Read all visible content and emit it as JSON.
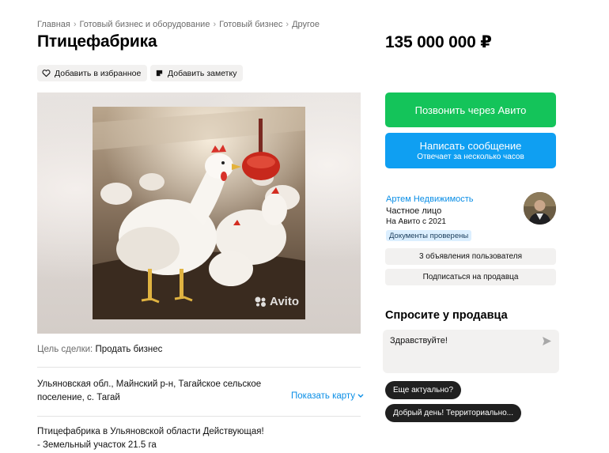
{
  "breadcrumb": [
    {
      "label": "Главная"
    },
    {
      "label": "Готовый бизнес и оборудование"
    },
    {
      "label": "Готовый бизнес"
    },
    {
      "label": "Другое"
    }
  ],
  "title": "Птицефабрика",
  "price": "135 000 000 ₽",
  "actions": {
    "favorite_label": "Добавить в избранное",
    "note_label": "Добавить заметку"
  },
  "gallery": {
    "watermark": "Avito"
  },
  "deal": {
    "label": "Цель сделки:",
    "value": "Продать бизнес"
  },
  "address": {
    "text": "Ульяновская обл., Майнский р-н, Тагайское сельское поселение, с. Тагай",
    "show_map_label": "Показать карту"
  },
  "description": {
    "line1": "Птицефабрика в Ульяновской области Действующая!",
    "line2": "- Земельный участок 21.5 га"
  },
  "contact": {
    "call_label": "Позвонить через Авито",
    "message_label": "Написать сообщение",
    "message_sub": "Отвечает за несколько часов"
  },
  "seller": {
    "name": "Артем Недвижимость",
    "type": "Частное лицо",
    "since": "На Авито с 2021",
    "verified_badge": "Документы проверены",
    "listings_label": "3 объявления пользователя",
    "subscribe_label": "Подписаться на продавца"
  },
  "ask": {
    "title": "Спросите у продавца",
    "message_value": "Здравствуйте!",
    "quick_questions": [
      "Еще актуально?",
      "Добрый день! Территориально..."
    ]
  },
  "colors": {
    "call_button": "#14c45a",
    "message_button": "#0f9ff2",
    "link": "#0a8ee6",
    "chip_bg": "#f2f1f0",
    "verified_bg": "#dcefff"
  }
}
